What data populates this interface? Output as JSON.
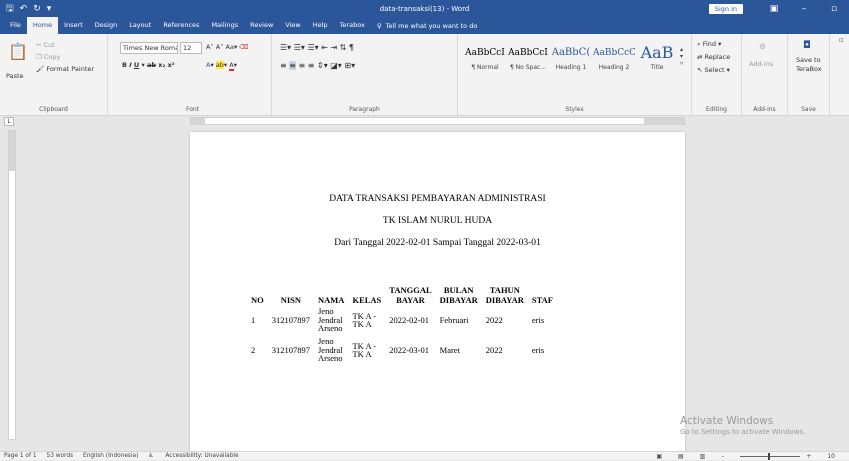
{
  "window": {
    "title": "data-transaksi(13) - Word",
    "signin": "Sign in"
  },
  "tabs": [
    "File",
    "Home",
    "Insert",
    "Design",
    "Layout",
    "References",
    "Mailings",
    "Review",
    "View",
    "Help",
    "Terabox"
  ],
  "active_tab": "Home",
  "tellme": "Tell me what you want to do",
  "ribbon": {
    "clipboard": {
      "paste": "Paste",
      "cut": "Cut",
      "copy": "Copy",
      "format_painter": "Format Painter",
      "label": "Clipboard"
    },
    "font": {
      "name": "Times New Roma",
      "size": "12",
      "label": "Font"
    },
    "paragraph": {
      "label": "Paragraph"
    },
    "styles": {
      "items": [
        {
          "sample": "AaBbCcI",
          "name": "¶ Normal"
        },
        {
          "sample": "AaBbCcI",
          "name": "¶ No Spac..."
        },
        {
          "sample": "AaBbC(",
          "name": "Heading 1"
        },
        {
          "sample": "AaBbCcC",
          "name": "Heading 2"
        },
        {
          "sample": "AaB",
          "name": "Title"
        }
      ],
      "label": "Styles"
    },
    "editing": {
      "find": "Find",
      "replace": "Replace",
      "select": "Select",
      "label": "Editing"
    },
    "addins": {
      "button": "Add-ins",
      "label": "Add-ins"
    },
    "save": {
      "button_line1": "Save to",
      "button_line2": "TeraBox",
      "label": "Save"
    }
  },
  "document": {
    "heading1": "DATA TRANSAKSI PEMBAYARAN ADMINISTRASI",
    "heading2": "TK ISLAM NURUL HUDA",
    "date_range": "Dari Tanggal 2022-02-01 Sampai Tanggal 2022-03-01",
    "table": {
      "headers": [
        "NO",
        "NISN",
        "NAMA",
        "KELAS",
        "TANGGAL BAYAR",
        "BULAN DIBAYAR",
        "TAHUN DIBAYAR",
        "STAF"
      ],
      "header_lines": [
        [
          "NO"
        ],
        [
          "NISN"
        ],
        [
          "NAMA"
        ],
        [
          "KELAS"
        ],
        [
          "TANGGAL",
          "BAYAR"
        ],
        [
          "BULAN",
          "DIBAYAR"
        ],
        [
          "TAHUN",
          "DIBAYAR"
        ],
        [
          "STAF"
        ]
      ],
      "rows": [
        {
          "no": "1",
          "nisn": "312107897",
          "nama": [
            "Jeno",
            "Jendral",
            "Arseno"
          ],
          "kelas": [
            "TK A -",
            "TK A"
          ],
          "tanggal": "2022-02-01",
          "bulan": "Februari",
          "tahun": "2022",
          "staf": "eris"
        },
        {
          "no": "2",
          "nisn": "312107897",
          "nama": [
            "Jeno",
            "Jendral",
            "Arseno"
          ],
          "kelas": [
            "TK A -",
            "TK A"
          ],
          "tanggal": "2022-03-01",
          "bulan": "Maret",
          "tahun": "2022",
          "staf": "eris"
        }
      ]
    }
  },
  "watermark": {
    "line1": "Activate Windows",
    "line2": "Go to Settings to activate Windows."
  },
  "status": {
    "page": "Page 1 of 1",
    "words": "53 words",
    "language": "English (Indonesia)",
    "accessibility": "Accessibility: Unavailable",
    "zoom": "10"
  },
  "colors": {
    "accent": "#2b579a",
    "ribbon_bg": "#f3f3f3",
    "canvas": "#e6e6e6"
  }
}
